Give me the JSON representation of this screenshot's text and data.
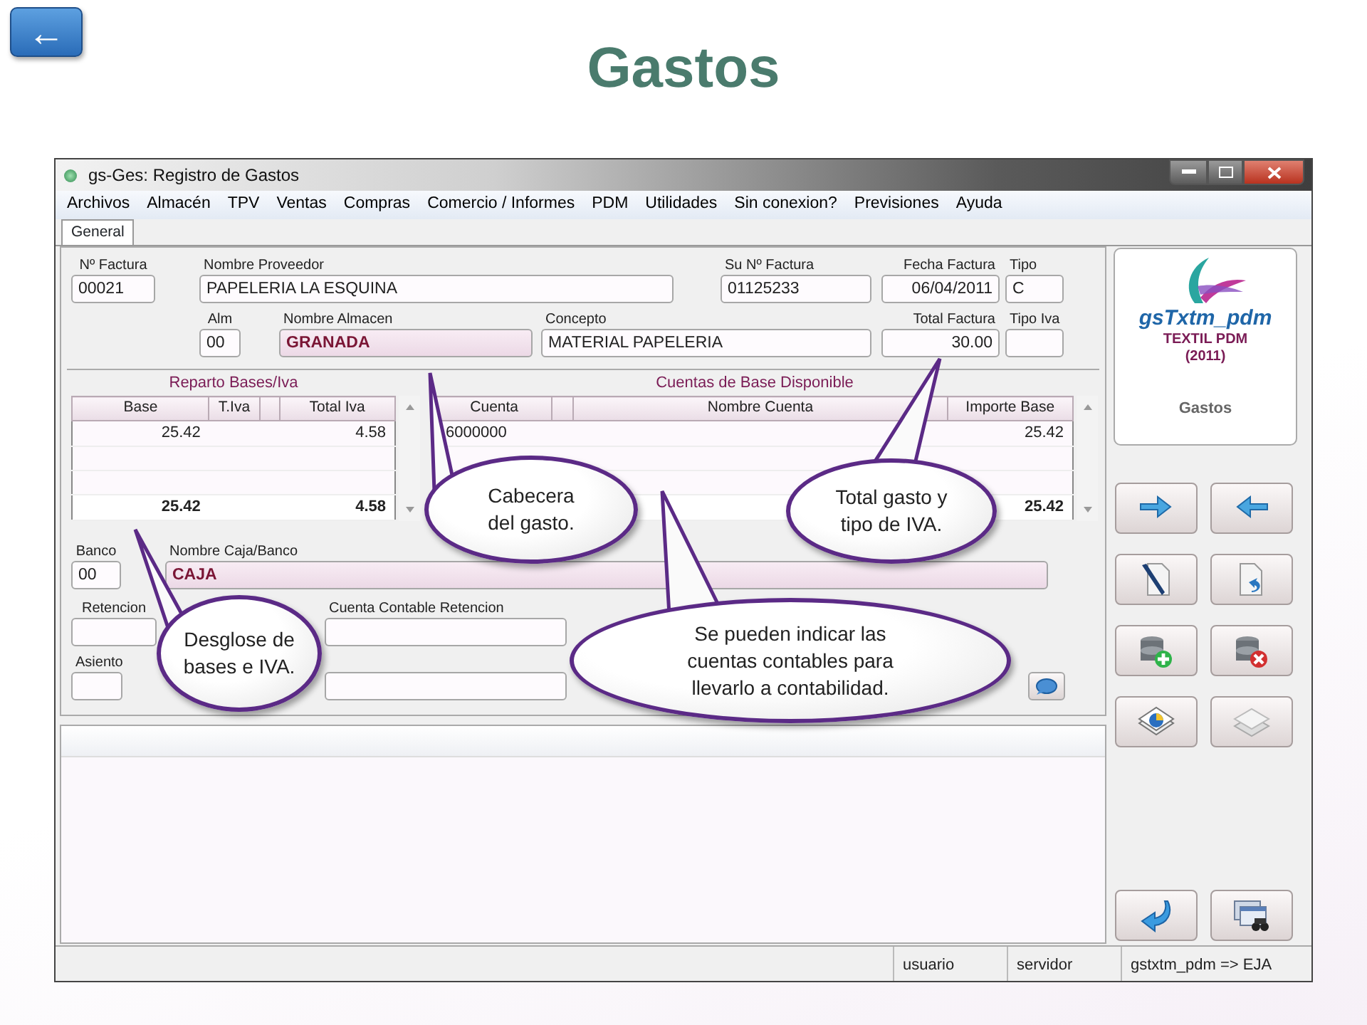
{
  "back_button": {
    "label": "←"
  },
  "slide_title": "Gastos",
  "window": {
    "title": "gs-Ges: Registro de Gastos"
  },
  "menu": [
    "Archivos",
    "Almacén",
    "TPV",
    "Ventas",
    "Compras",
    "Comercio / Informes",
    "PDM",
    "Utilidades",
    "Sin conexion?",
    "Previsiones",
    "Ayuda"
  ],
  "tabs": [
    {
      "label": "General",
      "selected": true
    }
  ],
  "header_rows": [
    [
      {
        "label": "Nº Factura",
        "value": "00021",
        "highlight": false
      },
      {
        "label": "Nombre Proveedor",
        "value": "PAPELERIA LA ESQUINA",
        "highlight": false
      },
      {
        "label": "Su Nº Factura",
        "value": "01125233",
        "highlight": false
      },
      {
        "label": "Fecha Factura",
        "value": "06/04/2011",
        "highlight": false
      },
      {
        "label": "Tipo",
        "value": "C",
        "highlight": false
      }
    ],
    [
      {
        "label": "Alm",
        "value": "00",
        "highlight": false
      },
      {
        "label": "Nombre Almacen",
        "value": "GRANADA",
        "highlight": true
      },
      {
        "label": "Concepto",
        "value": "MATERIAL PAPELERIA",
        "highlight": false
      },
      {
        "label": "Total Factura",
        "value": "30.00",
        "highlight": false
      },
      {
        "label": "Tipo Iva",
        "highlight": false
      }
    ]
  ],
  "bases_table": {
    "title": "Reparto Bases/Iva",
    "columns": {
      "base": "Base",
      "t_iva": "T.Iva",
      "total_iva": "Total Iva"
    },
    "rows": [
      {
        "base": "25.42",
        "total_iva": "4.58"
      },
      {},
      {}
    ],
    "totals": {
      "base": "25.42",
      "total_iva": "4.58"
    }
  },
  "accounts_table": {
    "title": "Cuentas de Base Disponible",
    "columns": {
      "cuenta": "Cuenta",
      "nombre_cuenta": "Nombre Cuenta",
      "importe_base": "Importe Base"
    },
    "rows": [
      {
        "cuenta": "6000000",
        "importe_base": "25.42"
      },
      {},
      {}
    ],
    "totals": {
      "importe_base": "25.42"
    }
  },
  "lower_rows": [
    [
      {
        "label": "Banco",
        "value": "00",
        "highlight": false
      },
      {
        "label": "Nombre Caja/Banco",
        "value": "CAJA",
        "highlight": true
      }
    ],
    [
      {
        "label": "Retencion",
        "highlight": false
      },
      {
        "label": "Cuenta Contable Retencion",
        "highlight": false
      }
    ],
    [
      {
        "label": "Asiento",
        "highlight": false
      },
      {
        "highlight": false
      }
    ]
  ],
  "logo_panel": {
    "brand": "gsTxtm_pdm",
    "company": "TEXTIL PDM",
    "year": "(2011)",
    "module": "Gastos"
  },
  "status_bar": [
    "usuario",
    "servidor",
    "gstxtm_pdm => EJA"
  ],
  "callouts": [
    {
      "lines": [
        "Cabecera",
        "del gasto."
      ]
    },
    {
      "lines": [
        "Total gasto y",
        "tipo de IVA."
      ]
    },
    {
      "lines": [
        "Desglose de",
        "bases e IVA."
      ]
    },
    {
      "lines": [
        "Se pueden indicar las",
        "cuentas contables para",
        "llevarlo a contabilidad."
      ]
    }
  ]
}
